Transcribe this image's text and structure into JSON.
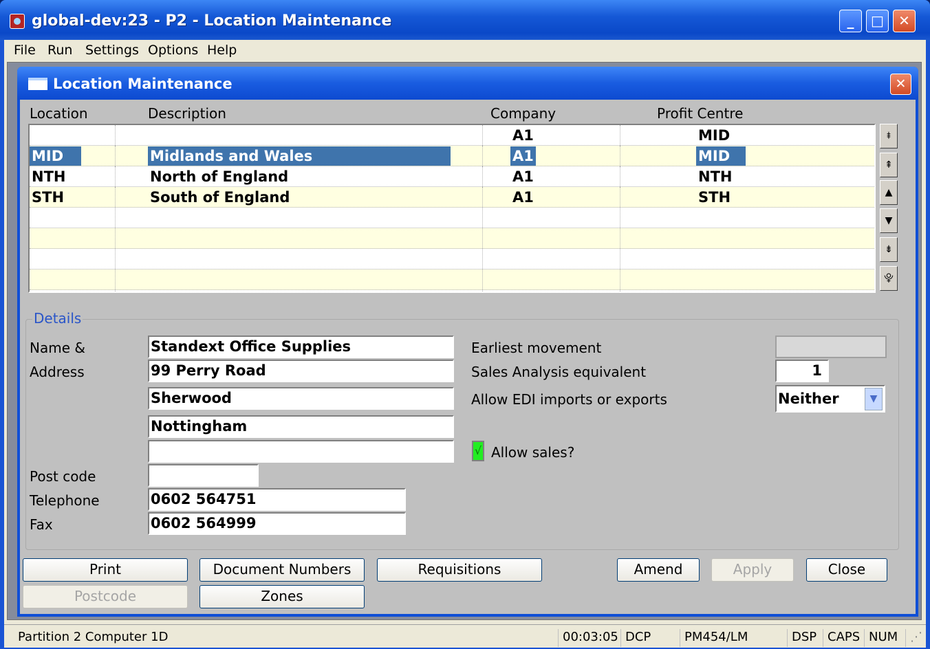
{
  "window": {
    "title": "global-dev:23 - P2 - Location Maintenance",
    "min": "_",
    "max": "□",
    "close": "✕"
  },
  "menu": [
    "File",
    "Run",
    "Settings",
    "Options",
    "Help"
  ],
  "dialog": {
    "title": "Location Maintenance",
    "close": "✕"
  },
  "grid": {
    "headers": [
      "Location",
      "Description",
      "Company",
      "Profit Centre"
    ],
    "rows": [
      {
        "location": "",
        "description": "",
        "company": "A1",
        "profit_centre": "MID"
      },
      {
        "location": "MID",
        "description": "Midlands and Wales",
        "company": "A1",
        "profit_centre": "MID"
      },
      {
        "location": "NTH",
        "description": "North of England",
        "company": "A1",
        "profit_centre": "NTH"
      },
      {
        "location": "STH",
        "description": "South of England",
        "company": "A1",
        "profit_centre": "STH"
      }
    ],
    "selected_row": 1,
    "scroll_buttons": [
      "⯒",
      "⇞",
      "▲",
      "▼",
      "⇟",
      "⯓"
    ]
  },
  "details": {
    "legend": "Details",
    "name_label": "Name &",
    "address_label": "Address",
    "address_lines": [
      "Standext Office Supplies",
      "99 Perry Road",
      "Sherwood",
      "Nottingham",
      ""
    ],
    "postcode_label": "Post code",
    "postcode": "",
    "telephone_label": "Telephone",
    "telephone": "0602 564751",
    "fax_label": "Fax",
    "fax": "0602 564999",
    "earliest_movement_label": "Earliest movement",
    "earliest_movement": "",
    "sales_analysis_label": "Sales Analysis equivalent",
    "sales_analysis": "1",
    "edi_label": "Allow EDI imports or exports",
    "edi_value": "Neither",
    "allow_sales_label": "Allow sales?",
    "allow_sales_check": "√"
  },
  "buttons": {
    "print": "Print",
    "document_numbers": "Document Numbers",
    "requisitions": "Requisitions",
    "amend": "Amend",
    "apply": "Apply",
    "close": "Close",
    "postcode": "Postcode",
    "zones": "Zones"
  },
  "status": [
    "Partition 2 Computer 1D",
    "00:03:05",
    "DCP",
    "PM454/LM",
    "DSP",
    "CAPS",
    "NUM"
  ]
}
